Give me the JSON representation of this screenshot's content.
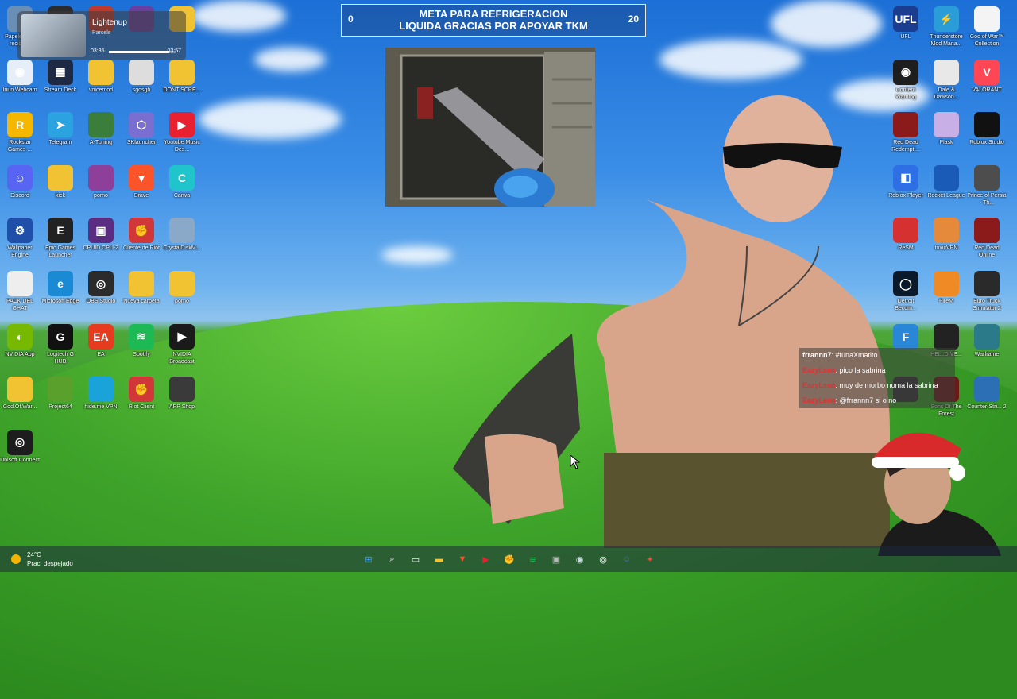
{
  "goal": {
    "min": "0",
    "max": "20",
    "text_line1": "META PARA REFRIGERACION",
    "text_line2": "LIQUIDA GRACIAS POR APOYAR TKM"
  },
  "media": {
    "title": "Lightenup",
    "artist": "Parcels",
    "elapsed": "03:35",
    "total": "03:57",
    "progress": 0.9
  },
  "weather": {
    "temp": "24°C",
    "condition": "Prac. despejado"
  },
  "chat": [
    {
      "user": "frrannn7",
      "message": ": #funaXmatito",
      "user_color": "#ffffff"
    },
    {
      "user": "EazyLean",
      "message": ": pico la sabrina",
      "user_color": "#e23131"
    },
    {
      "user": "EazyLean",
      "message": ": muy de morbo noma la sabrina",
      "user_color": "#e23131"
    },
    {
      "user": "EazyLean",
      "message": ": @frrannn7 si o no",
      "user_color": "#e23131"
    }
  ],
  "desktop_left": [
    {
      "label": "Papelera de reciclaje",
      "icon": "recycle-bin-icon",
      "color": "#6a8fb5",
      "glyph": ""
    },
    {
      "label": "",
      "icon": "obs-icon",
      "color": "#2b2b2b",
      "glyph": ""
    },
    {
      "label": "",
      "icon": "app-icon",
      "color": "#c0392b",
      "glyph": ""
    },
    {
      "label": "",
      "icon": "app-icon",
      "color": "#6b3fa0",
      "glyph": ""
    },
    {
      "label": "",
      "icon": "folder-icon",
      "color": "#f1c232",
      "glyph": ""
    },
    {
      "label": "Iriun Webcam",
      "icon": "webcam-icon",
      "color": "#e6eef8",
      "glyph": "◉"
    },
    {
      "label": "Stream Deck",
      "icon": "stream-deck-icon",
      "color": "#1e2a44",
      "glyph": "▦"
    },
    {
      "label": "voicemod",
      "icon": "folder-icon",
      "color": "#f1c232",
      "glyph": ""
    },
    {
      "label": "sgdsgh",
      "icon": "image-icon",
      "color": "#ddd",
      "glyph": ""
    },
    {
      "label": "DONT SCRE...",
      "icon": "folder-icon",
      "color": "#f1c232",
      "glyph": ""
    },
    {
      "label": "Rockstar Games ...",
      "icon": "rockstar-icon",
      "color": "#f5b700",
      "glyph": "R"
    },
    {
      "label": "Telegram",
      "icon": "telegram-icon",
      "color": "#2aa3e0",
      "glyph": "➤"
    },
    {
      "label": "A-Tuning",
      "icon": "tuning-icon",
      "color": "#3b7d3b",
      "glyph": ""
    },
    {
      "label": "SKlauncher",
      "icon": "cube-icon",
      "color": "#7a6fd1",
      "glyph": "⬡"
    },
    {
      "label": "Youtube Music Des...",
      "icon": "youtube-music-icon",
      "color": "#e8202f",
      "glyph": "▶"
    },
    {
      "label": "Discord",
      "icon": "discord-icon",
      "color": "#5865f2",
      "glyph": "☺"
    },
    {
      "label": "kick",
      "icon": "folder-icon",
      "color": "#f1c232",
      "glyph": ""
    },
    {
      "label": "porno",
      "icon": "winrar-icon",
      "color": "#8e3f9a",
      "glyph": ""
    },
    {
      "label": "Brave",
      "icon": "brave-icon",
      "color": "#fb542b",
      "glyph": "▼"
    },
    {
      "label": "Canva",
      "icon": "canva-icon",
      "color": "#20c4cb",
      "glyph": "C"
    },
    {
      "label": "Wallpaper Engine",
      "icon": "wallpaper-engine-icon",
      "color": "#1f4fa8",
      "glyph": "⚙"
    },
    {
      "label": "Epic Games Launcher",
      "icon": "epic-games-icon",
      "color": "#222",
      "glyph": "E"
    },
    {
      "label": "CPUID CPU-Z",
      "icon": "cpuz-icon",
      "color": "#5a2d82",
      "glyph": "▣"
    },
    {
      "label": "Cliente de Riot",
      "icon": "riot-icon",
      "color": "#d13639",
      "glyph": "✊"
    },
    {
      "label": "CrystalDiskM...",
      "icon": "disk-icon",
      "color": "#8aa8c8",
      "glyph": ""
    },
    {
      "label": "PACK DEL GHAT",
      "icon": "archive-icon",
      "color": "#eee",
      "glyph": ""
    },
    {
      "label": "Microsoft Edge",
      "icon": "edge-icon",
      "color": "#1a8ad4",
      "glyph": "e"
    },
    {
      "label": "OBS Studio",
      "icon": "obs-icon",
      "color": "#2b2b2b",
      "glyph": "◎"
    },
    {
      "label": "Nueva carpeta",
      "icon": "folder-icon",
      "color": "#f1c232",
      "glyph": ""
    },
    {
      "label": "porno",
      "icon": "folder-icon",
      "color": "#f1c232",
      "glyph": ""
    },
    {
      "label": "NVIDIA App",
      "icon": "nvidia-icon",
      "color": "#76b900",
      "glyph": "◐"
    },
    {
      "label": "Logitech G HUB",
      "icon": "logitech-icon",
      "color": "#111",
      "glyph": "G"
    },
    {
      "label": "EA",
      "icon": "ea-icon",
      "color": "#e63b1f",
      "glyph": "EA"
    },
    {
      "label": "Spotify",
      "icon": "spotify-icon",
      "color": "#1db954",
      "glyph": "≋"
    },
    {
      "label": "NVIDIA Broadcast",
      "icon": "nvidia-broadcast-icon",
      "color": "#1a1a1a",
      "glyph": "▶"
    },
    {
      "label": "God.Of.War...",
      "icon": "folder-icon",
      "color": "#f1c232",
      "glyph": ""
    },
    {
      "label": "Project64",
      "icon": "project64-icon",
      "color": "#5aa02c",
      "glyph": ""
    },
    {
      "label": "hide.me VPN",
      "icon": "vpn-icon",
      "color": "#1aa3d9",
      "glyph": ""
    },
    {
      "label": "Riot Client",
      "icon": "riot-icon",
      "color": "#d13639",
      "glyph": "✊"
    },
    {
      "label": "APP Shop",
      "icon": "app-shop-icon",
      "color": "#3a3a3a",
      "glyph": ""
    },
    {
      "label": "Ubisoft Connect",
      "icon": "ubisoft-icon",
      "color": "#1d1d1d",
      "glyph": "◎"
    }
  ],
  "desktop_right": [
    {
      "label": "UFL",
      "icon": "ufl-icon",
      "color": "#1b3d8f",
      "glyph": "UFL"
    },
    {
      "label": "Thunderstore Mod Mana...",
      "icon": "thunderstore-icon",
      "color": "#2a9dd8",
      "glyph": "⚡"
    },
    {
      "label": "God of War™ Collection",
      "icon": "file-icon",
      "color": "#f4f4f4",
      "glyph": ""
    },
    {
      "label": "Content Warning",
      "icon": "content-warning-icon",
      "color": "#1e1e1e",
      "glyph": "◉"
    },
    {
      "label": "Dale & Dawson...",
      "icon": "printer-icon",
      "color": "#e8e8e8",
      "glyph": ""
    },
    {
      "label": "VALORANT",
      "icon": "valorant-icon",
      "color": "#ff4655",
      "glyph": "V"
    },
    {
      "label": "Red Dead Redempti...",
      "icon": "rdr-icon",
      "color": "#8b1a1a",
      "glyph": ""
    },
    {
      "label": "Plask",
      "icon": "plask-icon",
      "color": "#c8b0e6",
      "glyph": ""
    },
    {
      "label": "Roblox Studio",
      "icon": "roblox-studio-icon",
      "color": "#111",
      "glyph": ""
    },
    {
      "label": "Roblox Player",
      "icon": "roblox-player-icon",
      "color": "#2e6fe6",
      "glyph": "◧"
    },
    {
      "label": "Rocket League",
      "icon": "rocket-league-icon",
      "color": "#1a5bb8",
      "glyph": ""
    },
    {
      "label": "Prince of Persia - Th...",
      "icon": "pop-icon",
      "color": "#4d4d4d",
      "glyph": ""
    },
    {
      "label": "ReSM",
      "icon": "resm-icon",
      "color": "#d63131",
      "glyph": ""
    },
    {
      "label": "toxicVPN",
      "icon": "toxic-vpn-icon",
      "color": "#e58a3a",
      "glyph": ""
    },
    {
      "label": "Red Dead Online",
      "icon": "rdo-icon",
      "color": "#8b1a1a",
      "glyph": ""
    },
    {
      "label": "Detroit Becom...",
      "icon": "detroit-icon",
      "color": "#0b1a2a",
      "glyph": "◯"
    },
    {
      "label": "FireM",
      "icon": "firem-icon",
      "color": "#f08a24",
      "glyph": ""
    },
    {
      "label": "Euro Truck Simulator 2",
      "icon": "ets2-icon",
      "color": "#2a2a2a",
      "glyph": ""
    },
    {
      "label": "",
      "icon": "app-icon",
      "color": "#2a86d6",
      "glyph": "F"
    },
    {
      "label": "HELLDIVE...",
      "icon": "helldivers-icon",
      "color": "#222",
      "glyph": ""
    },
    {
      "label": "Warframe",
      "icon": "warframe-icon",
      "color": "#2a7a8a",
      "glyph": ""
    },
    {
      "label": "",
      "icon": "app-icon",
      "color": "#333",
      "glyph": ""
    },
    {
      "label": "Sons Of The Forest",
      "icon": "sotf-icon",
      "color": "#6b1a1a",
      "glyph": ""
    },
    {
      "label": "Counter-Stri... 2",
      "icon": "cs2-icon",
      "color": "#2c6fb5",
      "glyph": ""
    }
  ],
  "taskbar": [
    {
      "icon": "windows-start-icon",
      "glyph": "⊞",
      "color": "#3aa0ff"
    },
    {
      "icon": "search-icon",
      "glyph": "⌕",
      "color": "#ffffff"
    },
    {
      "icon": "task-view-icon",
      "glyph": "▭",
      "color": "#ffffff"
    },
    {
      "icon": "file-explorer-icon",
      "glyph": "▬",
      "color": "#f1c232"
    },
    {
      "icon": "brave-icon",
      "glyph": "▼",
      "color": "#fb542b"
    },
    {
      "icon": "youtube-music-icon",
      "glyph": "▶",
      "color": "#e8202f"
    },
    {
      "icon": "riot-icon",
      "glyph": "✊",
      "color": "#d13639"
    },
    {
      "icon": "spotify-icon",
      "glyph": "≋",
      "color": "#1db954"
    },
    {
      "icon": "cpuz-icon",
      "glyph": "▣",
      "color": "#bbbbbb"
    },
    {
      "icon": "steam-icon",
      "glyph": "◉",
      "color": "#c7d5e0"
    },
    {
      "icon": "obs-icon",
      "glyph": "◎",
      "color": "#ffffff"
    },
    {
      "icon": "discord-icon",
      "glyph": "☺",
      "color": "#5865f2"
    },
    {
      "icon": "app-icon",
      "glyph": "✦",
      "color": "#e74c3c"
    }
  ]
}
